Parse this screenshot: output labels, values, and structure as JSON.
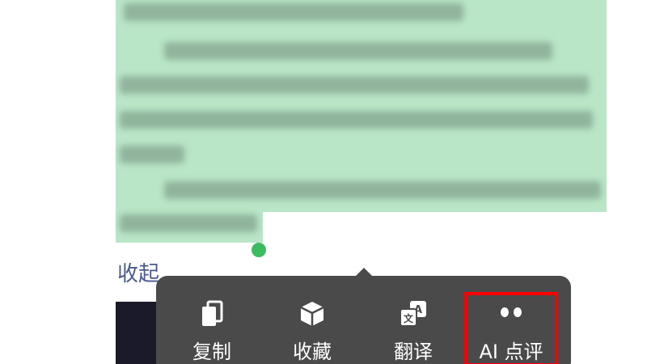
{
  "selected_text": {
    "highlight_color": "#b9e6c6",
    "blurred": true
  },
  "collapse_label": "收起",
  "popup": {
    "background": "#4a4a4a",
    "actions": [
      {
        "label": "复制",
        "icon": "copy-icon"
      },
      {
        "label": "收藏",
        "icon": "favorite-cube-icon"
      },
      {
        "label": "翻译",
        "icon": "translate-icon"
      },
      {
        "label": "AI 点评",
        "icon": "ai-eyes-icon",
        "highlighted": true
      }
    ]
  },
  "annotation": {
    "color": "#ff0000",
    "target": "AI 点评"
  }
}
